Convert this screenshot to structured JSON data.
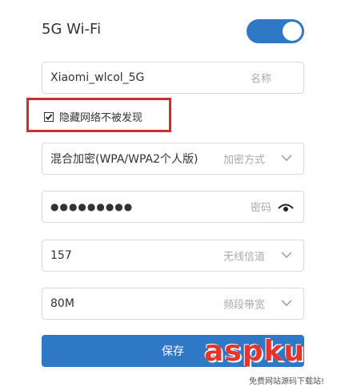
{
  "wifi": {
    "title": "5G Wi-Fi",
    "enabled": true
  },
  "ssid": {
    "value": "Xiaomi_wlcol_5G",
    "hint": "名称"
  },
  "hide_network": {
    "label": "隐藏网络不被发现",
    "checked": true
  },
  "encryption": {
    "value": "混合加密(WPA/WPA2个人版)",
    "hint": "加密方式"
  },
  "password": {
    "value": "●●●●●●●●●",
    "hint": "密码"
  },
  "channel": {
    "value": "157",
    "hint": "无线信道"
  },
  "bandwidth": {
    "value": "80M",
    "hint": "频段带宽"
  },
  "save_label": "保存",
  "watermark": {
    "main": "aspku",
    "sub": "免费网站源码下载站!"
  },
  "colors": {
    "accent": "#2f78c6",
    "highlight": "#d12d2d"
  }
}
